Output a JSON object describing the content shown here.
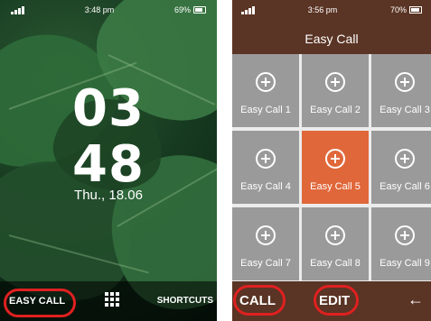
{
  "lock_screen": {
    "status_time": "3:48 pm",
    "battery_level": "69%",
    "clock_hour": "03",
    "clock_minute": "48",
    "date": "Thu., 18.06",
    "soft_left": "EASY CALL",
    "soft_right": "SHORTCUTS",
    "center_icon": "apps-grid-icon"
  },
  "easy_call": {
    "status_time": "3:56 pm",
    "battery_level": "70%",
    "title": "Easy Call",
    "tiles": [
      {
        "label": "Easy Call 1",
        "icon": "add-circle-icon"
      },
      {
        "label": "Easy Call 2",
        "icon": "add-circle-icon"
      },
      {
        "label": "Easy Call 3",
        "icon": "add-circle-icon"
      },
      {
        "label": "Easy Call 4",
        "icon": "add-circle-icon"
      },
      {
        "label": "Easy Call 5",
        "icon": "add-circle-icon",
        "selected": true
      },
      {
        "label": "Easy Call 6",
        "icon": "add-circle-icon"
      },
      {
        "label": "Easy Call 7",
        "icon": "add-circle-icon"
      },
      {
        "label": "Easy Call 8",
        "icon": "add-circle-icon"
      },
      {
        "label": "Easy Call 9",
        "icon": "add-circle-icon"
      }
    ],
    "soft_left": "CALL",
    "soft_center": "EDIT",
    "soft_right": "←"
  },
  "colors": {
    "header_brown": "#5a3424",
    "tile_gray": "#9a9a9a",
    "tile_selected": "#e0673a",
    "highlight_red": "#e02020"
  }
}
